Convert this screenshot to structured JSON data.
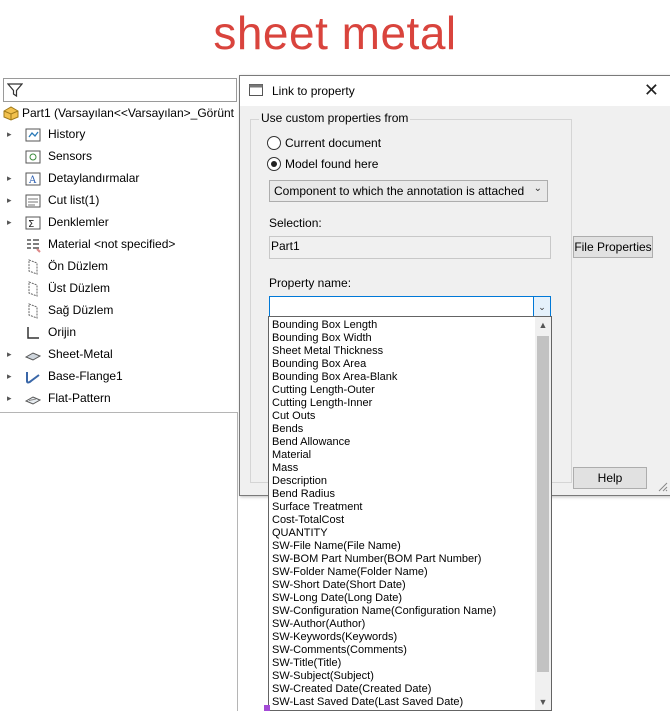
{
  "banner": {
    "text": "sheet metal",
    "color": "#d9443d"
  },
  "tree": {
    "filter_icon": "filter-icon",
    "part_label": "Part1  (Varsayılan<<Varsayılan>_Görünt",
    "items": [
      {
        "label": "History",
        "icon": "history-icon",
        "expandable": true
      },
      {
        "label": "Sensors",
        "icon": "sensors-icon",
        "expandable": false
      },
      {
        "label": "Detaylandırmalar",
        "icon": "annotations-icon",
        "expandable": true
      },
      {
        "label": "Cut list(1)",
        "icon": "cut-list-icon",
        "expandable": true
      },
      {
        "label": "Denklemler",
        "icon": "equations-icon",
        "expandable": true
      },
      {
        "label": "Material <not specified>",
        "icon": "material-icon",
        "expandable": false
      },
      {
        "label": "Ön Düzlem",
        "icon": "plane-icon",
        "expandable": false
      },
      {
        "label": "Üst Düzlem",
        "icon": "plane-icon",
        "expandable": false
      },
      {
        "label": "Sağ Düzlem",
        "icon": "plane-icon",
        "expandable": false
      },
      {
        "label": "Orijin",
        "icon": "origin-icon",
        "expandable": false
      },
      {
        "label": "Sheet-Metal",
        "icon": "sheet-metal-icon",
        "expandable": true
      },
      {
        "label": "Base-Flange1",
        "icon": "base-flange-icon",
        "expandable": true
      },
      {
        "label": "Flat-Pattern",
        "icon": "flat-pattern-icon",
        "expandable": true
      }
    ]
  },
  "dialog": {
    "title": "Link to property",
    "close": "✕",
    "group_label": "Use custom properties from",
    "radio_current": "Current document",
    "radio_model": "Model found here",
    "selected_radio": "Model found here",
    "combo_value": "Component to which the annotation is attached",
    "selection_label": "Selection:",
    "selection_value": "Part1",
    "file_properties_button": "File Properties",
    "property_name_label": "Property name:",
    "property_name_value": "",
    "help_button": "Help",
    "options": [
      "Bounding Box Length",
      "Bounding Box Width",
      "Sheet Metal Thickness",
      "Bounding Box Area",
      "Bounding Box Area-Blank",
      "Cutting Length-Outer",
      "Cutting Length-Inner",
      "Cut Outs",
      "Bends",
      "Bend Allowance",
      "Material",
      "Mass",
      "Description",
      "Bend Radius",
      "Surface Treatment",
      "Cost-TotalCost",
      "QUANTITY",
      "SW-File Name(File Name)",
      "SW-BOM Part Number(BOM Part Number)",
      "SW-Folder Name(Folder Name)",
      "SW-Short Date(Short Date)",
      "SW-Long Date(Long Date)",
      "SW-Configuration Name(Configuration Name)",
      "SW-Author(Author)",
      "SW-Keywords(Keywords)",
      "SW-Comments(Comments)",
      "SW-Title(Title)",
      "SW-Subject(Subject)",
      "SW-Created Date(Created Date)",
      "SW-Last Saved Date(Last Saved Date)"
    ]
  }
}
